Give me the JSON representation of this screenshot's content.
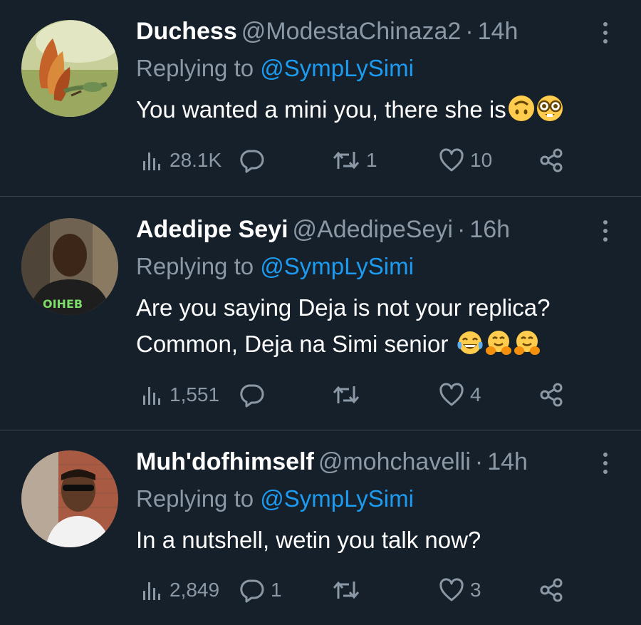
{
  "tweets": [
    {
      "name": "Duchess",
      "handle": "@ModestaChinaza2",
      "time": "14h",
      "replying_prefix": "Replying to ",
      "replying_to": "@SympLySimi",
      "text": "You wanted a mini you, there she is",
      "emojis": [
        "upside-down-face",
        "nerd-face"
      ],
      "views": "28.1K",
      "replies": "",
      "retweets": "1",
      "likes": "10"
    },
    {
      "name": "Adedipe Seyi",
      "handle": "@AdedipeSeyi",
      "time": "16h",
      "replying_prefix": "Replying to ",
      "replying_to": "@SympLySimi",
      "text_line1": "Are you saying Deja is not your replica?",
      "text_line2": "Common, Deja na Simi senior ",
      "emojis": [
        "tears-of-joy",
        "hugging-face",
        "hugging-face"
      ],
      "views": "1,551",
      "replies": "",
      "retweets": "",
      "likes": "4"
    },
    {
      "name": "Muh'dofhimself",
      "handle": "@mohchavelli",
      "time": "14h",
      "replying_prefix": "Replying to ",
      "replying_to": "@SympLySimi",
      "text": "In a nutshell, wetin you talk now?",
      "views": "2,849",
      "replies": "1",
      "retweets": "",
      "likes": "3"
    }
  ],
  "separator": "·",
  "colors": {
    "background": "#15202b",
    "divider": "#38444d",
    "secondary_text": "#8b98a5",
    "link": "#1d9bf0"
  },
  "icons": [
    "views-icon",
    "reply-icon",
    "retweet-icon",
    "like-icon",
    "share-icon",
    "more-icon"
  ]
}
